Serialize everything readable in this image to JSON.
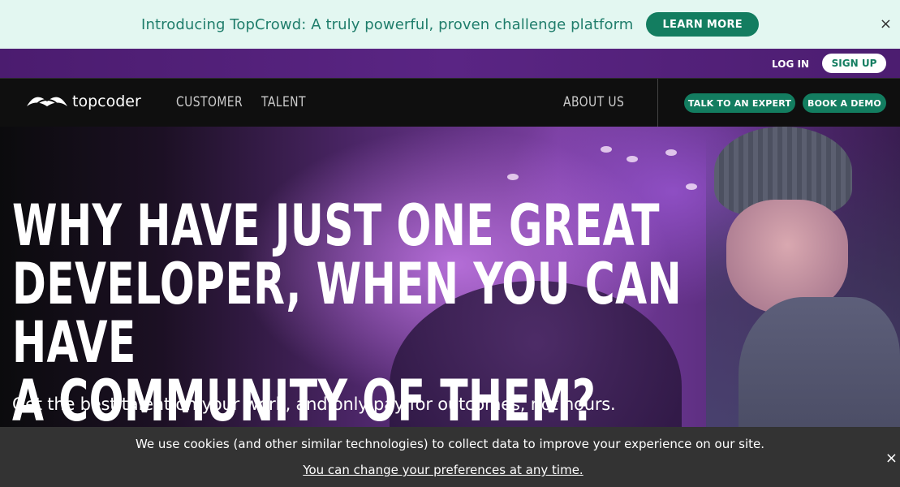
{
  "announcement": {
    "text": "Introducing TopCrowd: A truly powerful, proven challenge platform",
    "button": "LEARN MORE",
    "close": "×"
  },
  "topbar": {
    "login": "LOG IN",
    "signup": "SIGN UP"
  },
  "nav": {
    "logo_text": "topcoder",
    "links": [
      "CUSTOMER",
      "TALENT",
      "ABOUT US"
    ],
    "cta_expert": "TALK TO AN EXPERT",
    "cta_demo": "BOOK A DEMO"
  },
  "hero": {
    "headline": [
      "WHY HAVE JUST ONE GREAT",
      "DEVELOPER, WHEN YOU CAN HAVE",
      "A COMMUNITY OF THEM?"
    ],
    "subline": "Get the best talent on your work, and only pay for outcomes, not hours."
  },
  "cookie": {
    "text": "We use cookies (and other similar technologies) to collect data to improve your experience on our site.",
    "link": "You can change your preferences at any time.",
    "close": "×"
  },
  "colors": {
    "accent_green": "#137d60",
    "announce_bg": "#e3f7f1",
    "topbar_purple": "#4b1c6f"
  }
}
